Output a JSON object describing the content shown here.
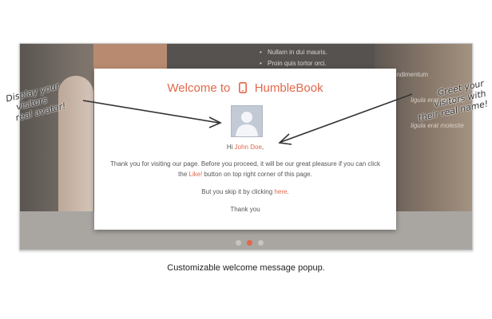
{
  "background_page": {
    "list_items": [
      "Nullam in dui mauris.",
      "Proin quis tortor orci.",
      "Donec congue lacinia dui, a porttitor lectus condimentum"
    ],
    "side_text_1": "ligula erat molestie",
    "side_text_2": "ligula erat molestie"
  },
  "popup": {
    "title_prefix": "Welcome to",
    "title_brand": "HumbleBook",
    "phone_icon": "phone-icon",
    "avatar_icon": "avatar-placeholder-icon",
    "greeting_prefix": "Hi",
    "user_name": "John Doe",
    "greeting_suffix": ",",
    "line1": "Thank you for visiting our page. Before you proceed, it will be our great pleasure if you can click",
    "line2_prefix": "the",
    "line2_link": "Like!",
    "line2_suffix": "button on top right corner of this page.",
    "skip_prefix": "But you skip it by clicking",
    "skip_link": "here",
    "skip_suffix": ".",
    "closing": "Thank you"
  },
  "annotations": {
    "left": [
      "Display your",
      "visitors",
      "real avatar!"
    ],
    "right": [
      "Greet your",
      "visitors with",
      "their real name!"
    ]
  },
  "caption": "Customizable welcome message popup.",
  "colors": {
    "accent": "#e2684a",
    "text": "#555555"
  }
}
